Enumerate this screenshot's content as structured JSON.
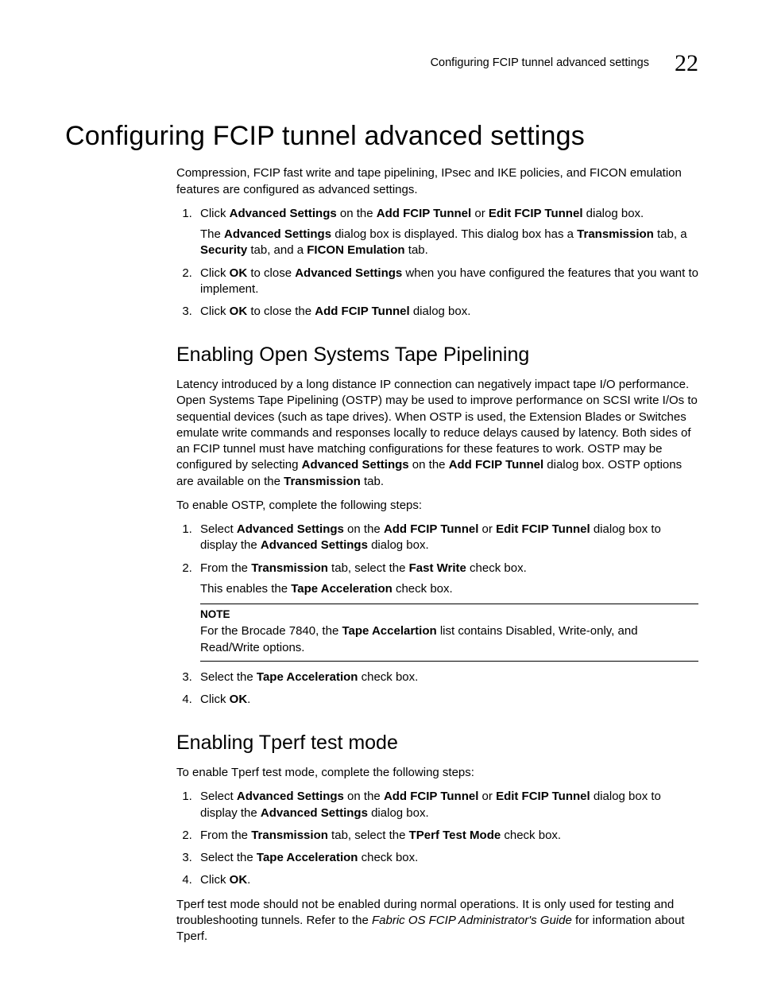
{
  "header": {
    "running_title": "Configuring FCIP tunnel advanced settings",
    "chapter_number": "22"
  },
  "main": {
    "title": "Configuring FCIP tunnel advanced settings",
    "intro": {
      "prefix": "Compression, FCIP fast write and tape pipelining, IPsec and IKE policies, and FICON emulation features are configured as advanced settings."
    },
    "steps1": {
      "s1_a": "Click ",
      "s1_b": "Advanced Settings",
      "s1_c": " on the ",
      "s1_d": "Add FCIP Tunnel",
      "s1_e": " or ",
      "s1_f": "Edit FCIP Tunnel",
      "s1_g": " dialog box.",
      "s1_sub_a": "The ",
      "s1_sub_b": "Advanced Settings",
      "s1_sub_c": " dialog box is displayed. This dialog box has a ",
      "s1_sub_d": "Transmission",
      "s1_sub_e": " tab, a ",
      "s1_sub_f": "Security",
      "s1_sub_g": " tab, and a ",
      "s1_sub_h": "FICON Emulation",
      "s1_sub_i": " tab.",
      "s2_a": "Click ",
      "s2_b": "OK",
      "s2_c": " to close ",
      "s2_d": "Advanced Settings",
      "s2_e": " when you have configured the features that you want to implement.",
      "s3_a": "Click ",
      "s3_b": "OK",
      "s3_c": " to close the ",
      "s3_d": "Add FCIP Tunnel",
      "s3_e": " dialog box."
    },
    "ostp": {
      "heading": "Enabling Open Systems Tape Pipelining",
      "p1_a": "Latency introduced by a long distance IP connection can negatively impact tape I/O performance. Open Systems Tape Pipelining (OSTP) may be used to improve performance on SCSI write I/Os to sequential devices (such as tape drives). When OSTP is used, the Extension Blades or Switches emulate write commands and responses locally to reduce delays caused by latency. Both sides of an FCIP tunnel must have matching configurations for these features to work. OSTP may be configured by selecting ",
      "p1_b": "Advanced Settings",
      "p1_c": " on the ",
      "p1_d": "Add FCIP Tunnel",
      "p1_e": " dialog box. OSTP options are available on the ",
      "p1_f": "Transmission",
      "p1_g": " tab.",
      "p2": "To enable OSTP, complete the following steps:",
      "s1_a": "Select ",
      "s1_b": "Advanced Settings",
      "s1_c": " on the ",
      "s1_d": "Add FCIP Tunnel",
      "s1_e": " or ",
      "s1_f": "Edit FCIP Tunnel",
      "s1_g": " dialog box to display the ",
      "s1_h": "Advanced Settings",
      "s1_i": " dialog box.",
      "s2_a": "From the ",
      "s2_b": "Transmission",
      "s2_c": " tab, select the ",
      "s2_d": "Fast Write",
      "s2_e": " check box.",
      "s2_sub_a": "This enables the ",
      "s2_sub_b": "Tape Acceleration",
      "s2_sub_c": " check box.",
      "note_label": "NOTE",
      "note_a": "For the Brocade 7840, the ",
      "note_b": "Tape Accelartion",
      "note_c": " list contains Disabled, Write-only, and Read/Write options.",
      "s3_a": "Select the ",
      "s3_b": "Tape Acceleration",
      "s3_c": " check box.",
      "s4_a": "Click ",
      "s4_b": "OK",
      "s4_c": "."
    },
    "tperf": {
      "heading": "Enabling Tperf test mode",
      "p1": "To enable Tperf test mode, complete the following steps:",
      "s1_a": "Select ",
      "s1_b": "Advanced Settings",
      "s1_c": " on the ",
      "s1_d": "Add FCIP Tunnel",
      "s1_e": " or ",
      "s1_f": "Edit FCIP Tunnel",
      "s1_g": " dialog box to display the ",
      "s1_h": "Advanced Settings",
      "s1_i": " dialog box.",
      "s2_a": "From the ",
      "s2_b": "Transmission",
      "s2_c": " tab, select the ",
      "s2_d": "TPerf Test Mode",
      "s2_e": " check box.",
      "s3_a": "Select the ",
      "s3_b": "Tape Acceleration",
      "s3_c": " check box.",
      "s4_a": "Click ",
      "s4_b": "OK",
      "s4_c": ".",
      "p2_a": "Tperf test mode should not be enabled during normal operations. It is only used for testing and troubleshooting tunnels. Refer to the ",
      "p2_b": "Fabric OS FCIP Administrator's Guide",
      "p2_c": " for information about Tperf."
    }
  }
}
